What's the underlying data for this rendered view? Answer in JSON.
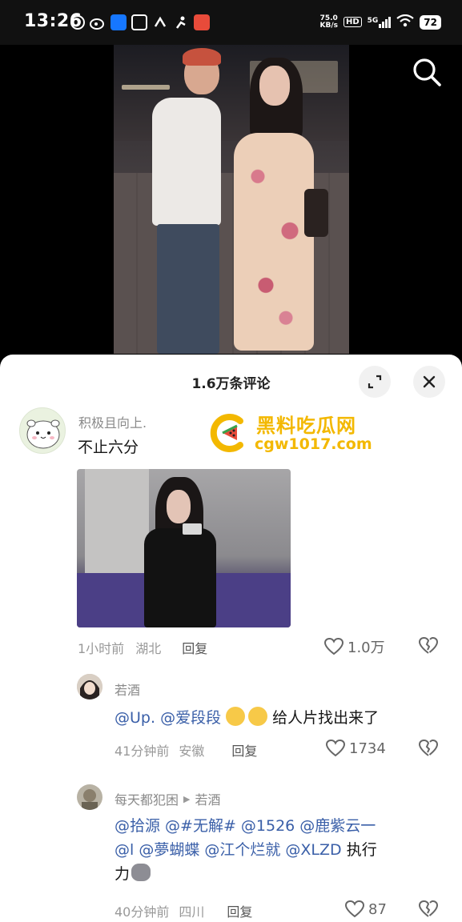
{
  "status_bar": {
    "time": "13:26",
    "net_speed_value": "75.0",
    "net_speed_unit": "KB/s",
    "hd": "HD",
    "signal": "5G",
    "battery": "72"
  },
  "comments_panel": {
    "title": "1.6万条评论"
  },
  "comments": [
    {
      "username": "积极且向上.",
      "text": "不止六分",
      "time": "1小时前",
      "location": "湖北",
      "reply_label": "回复",
      "likes": "1.0万"
    },
    {
      "username": "若酒",
      "text": "@Up. @爱段段 😰😰 给人片找出来了",
      "time": "41分钟前",
      "location": "安徽",
      "reply_label": "回复",
      "likes": "1734"
    },
    {
      "username": "每天都犯困",
      "reply_to": "若酒",
      "text_line1": "@拾源 @#无解# @1526 @鹿紫云一",
      "text_line2": "@l @夢蝴蝶 @江个烂就 @XLZD 执行",
      "text_line3": "力",
      "time": "40分钟前",
      "location": "四川",
      "reply_label": "回复",
      "likes": "87"
    }
  ],
  "watermark": {
    "title": "黑料吃瓜网",
    "url": "cgw1017.com"
  },
  "colors": {
    "mention": "#3a5fa8",
    "watermark": "#f3b800"
  }
}
